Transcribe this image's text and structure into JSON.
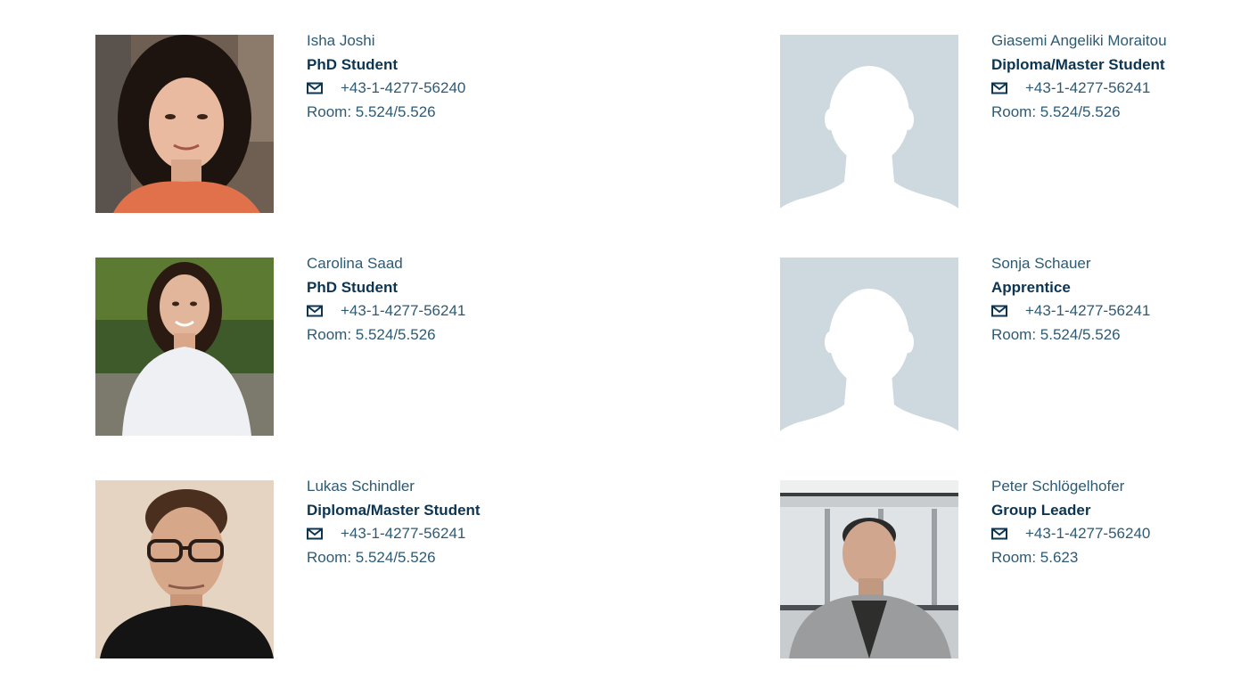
{
  "people": [
    {
      "name": "Isha Joshi",
      "role": "PhD Student",
      "phone": "+43-1-4277-56240",
      "room": "Room: 5.524/5.526",
      "photo": "photo"
    },
    {
      "name": "Giasemi Angeliki Moraitou",
      "role": "Diploma/Master Student",
      "phone": "+43-1-4277-56241",
      "room": "Room: 5.524/5.526",
      "photo": "placeholder-silhouette"
    },
    {
      "name": "Carolina Saad",
      "role": "PhD Student",
      "phone": "+43-1-4277-56241",
      "room": "Room: 5.524/5.526",
      "photo": "photo"
    },
    {
      "name": "Sonja Schauer",
      "role": "Apprentice",
      "phone": "+43-1-4277-56241",
      "room": "Room: 5.524/5.526",
      "photo": "placeholder-silhouette"
    },
    {
      "name": "Lukas Schindler",
      "role": "Diploma/Master Student",
      "phone": "+43-1-4277-56241",
      "room": "Room: 5.524/5.526",
      "photo": "photo"
    },
    {
      "name": "Peter Schlögelhofer",
      "role": "Group Leader",
      "phone": "+43-1-4277-56240",
      "room": "Room: 5.623",
      "photo": "photo"
    }
  ],
  "icons": {
    "contact": "mail-icon",
    "placeholder": "silhouette-icon"
  },
  "colors": {
    "text": "#2e5a73",
    "role": "#0b3552",
    "placeholder_bg": "#cdd8df"
  }
}
